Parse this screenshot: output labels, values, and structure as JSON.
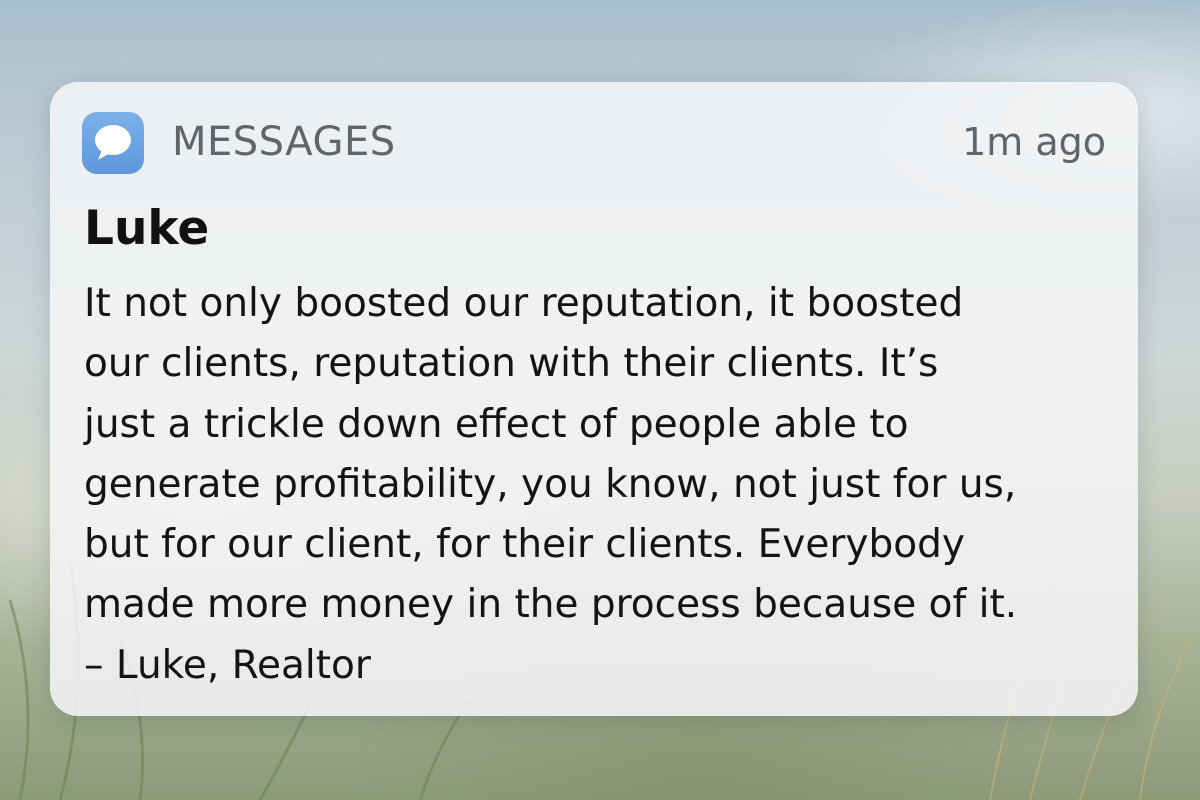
{
  "notification": {
    "app_name": "MESSAGES",
    "app_icon": "message-bubble-icon",
    "timestamp": "1m ago",
    "sender": "Luke",
    "body_lines": [
      "It not only boosted our reputation, it boosted",
      "our clients, reputation with their clients. It’s",
      "just a trickle down effect of people able to",
      "generate profitability, you know, not just for us,",
      "but for our client, for their clients. Everybody",
      "made more money in the process because of it.",
      "– Luke, Realtor"
    ]
  },
  "colors": {
    "icon_background": "#6aa3e2",
    "card_background": "#f4f6f7",
    "secondary_text": "#5f6568",
    "primary_text": "#141414"
  }
}
